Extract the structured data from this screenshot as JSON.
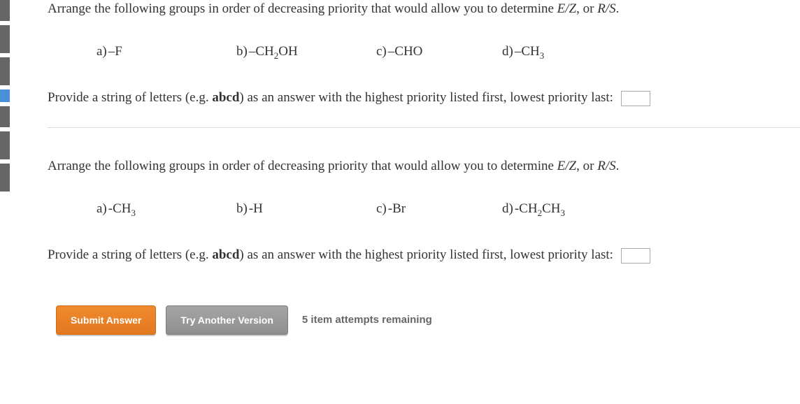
{
  "question1": {
    "prompt_a": "Arrange the following groups in order of decreasing priority that would allow you to determine ",
    "prompt_ital1": "E/Z",
    "prompt_b": ", or ",
    "prompt_ital2": "R/S",
    "prompt_c": ".",
    "options": {
      "a": {
        "label": "a)",
        "text": "–F"
      },
      "b": {
        "label": "b)",
        "text": "–CH",
        "sub": "2",
        "text2": "OH"
      },
      "c": {
        "label": "c)",
        "text": "–CHO"
      },
      "d": {
        "label": "d)",
        "text": "–CH",
        "sub": "3"
      }
    },
    "answer_a": "Provide a string of letters (e.g. ",
    "answer_bold": "abcd",
    "answer_b": ") as an answer with the highest priority listed first, lowest priority last:"
  },
  "question2": {
    "prompt_a": "Arrange the following groups in order of decreasing priority that would allow you to determine ",
    "prompt_ital1": "E/Z",
    "prompt_b": ", or ",
    "prompt_ital2": "R/S",
    "prompt_c": ".",
    "options": {
      "a": {
        "label": "a)",
        "text": "-CH",
        "sub": "3"
      },
      "b": {
        "label": "b)",
        "text": "-H"
      },
      "c": {
        "label": "c)",
        "text": "-Br"
      },
      "d": {
        "label": "d)",
        "text": "-CH",
        "sub": "2",
        "text2": "CH",
        "sub2": "3"
      }
    },
    "answer_a": "Provide a string of letters (e.g. ",
    "answer_bold": "abcd",
    "answer_b": ") as an answer with the highest priority listed first, lowest priority last:"
  },
  "buttons": {
    "submit": "Submit Answer",
    "try": "Try Another Version",
    "attempts": "5 item attempts remaining"
  }
}
